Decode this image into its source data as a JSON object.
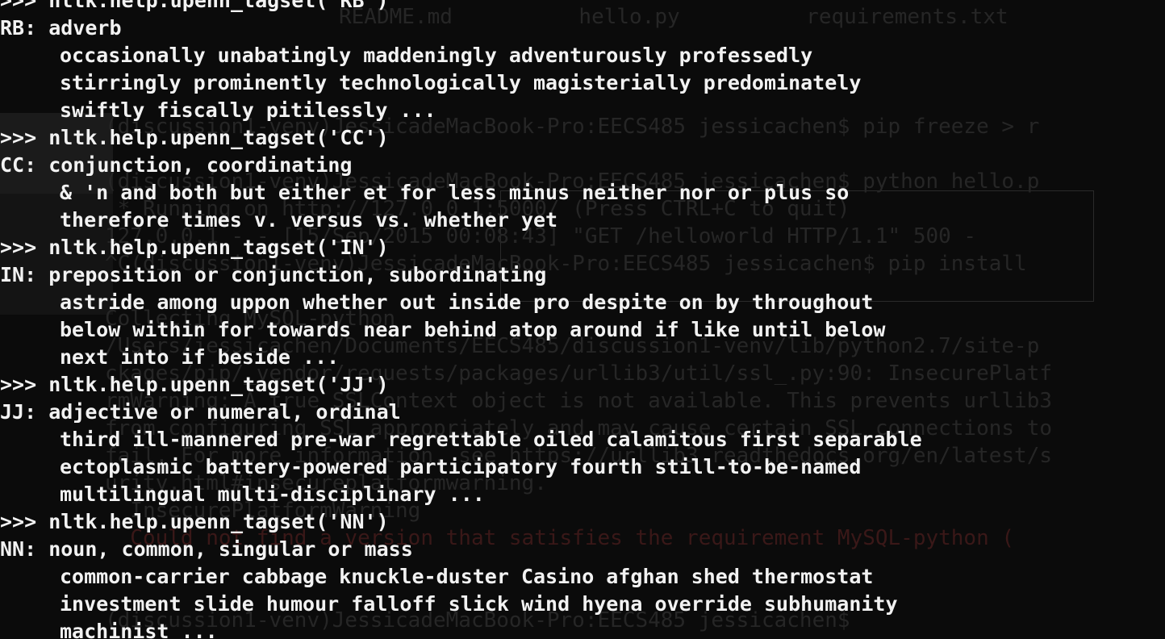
{
  "terminal": {
    "lines": [
      ">>> nltk.help.upenn_tagset('RB')",
      "RB: adverb",
      "occasionally unabatingly maddeningly adventurously professedly",
      "stirringly prominently technologically magisterially predominately",
      "swiftly fiscally pitilessly ...",
      ">>> nltk.help.upenn_tagset('CC')",
      "CC: conjunction, coordinating",
      "& 'n and both but either et for less minus neither nor or plus so",
      "therefore times v. versus vs. whether yet",
      ">>> nltk.help.upenn_tagset('IN')",
      "IN: preposition or conjunction, subordinating",
      "astride among uppon whether out inside pro despite on by throughout",
      "below within for towards near behind atop around if like until below",
      "next into if beside ...",
      ">>> nltk.help.upenn_tagset('JJ')",
      "JJ: adjective or numeral, ordinal",
      "third ill-mannered pre-war regrettable oiled calamitous first separable",
      "ectoplasmic battery-powered participatory fourth still-to-be-named",
      "multilingual multi-disciplinary ...",
      ">>> nltk.help.upenn_tagset('NN')",
      "NN: noun, common, singular or mass",
      "common-carrier cabbage knuckle-duster Casino afghan shed thermostat",
      "investment slide humour falloff slick wind hyena override subhumanity",
      "machinist ..."
    ]
  },
  "background": {
    "files": "README.md          hello.py          requirements.txt",
    "lines": [
      "(discussion1-venv)JessicadeMacBook-Pro:EECS485 jessicachen$ pip freeze > r",
      "(discussion1-venv)JessicadeMacBook-Pro:EECS485 jessicachen$ python hello.p",
      " * Running on http://127.0.0.1:5000/ (Press CTRL+C to quit)",
      "127.0.0.1 - - [15/Sep/2015 00:08:43] \"GET /helloworld HTTP/1.1\" 500 -",
      "^C(discussion1-venv)JessicadeMacBook-Pro:EECS485 jessicachen$ pip install",
      "Collecting MySQL-python",
      "/Users/jessicachen/Documents/EECS485/discussion1-venv/lib/python2.7/site-p",
      "ckages/pip/_vendor/requests/packages/urllib3/util/ssl_.py:90: InsecurePlatf",
      "rmWarning: A true SSLContext object is not available. This prevents urllib3",
      "from configuring SSL appropriately and may cause certain SSL connections to",
      "fail. For more information, see https://urllib3.readthedocs.org/en/latest/s",
      "urity.html#insecureplatformwarning.",
      "  InsecurePlatformWarning",
      "  Could not find a version that satisfies the requirement MySQL-python (",
      "(discussion1-venv)JessicadeMacBook-Pro:EECS485 jessicachen$"
    ]
  }
}
